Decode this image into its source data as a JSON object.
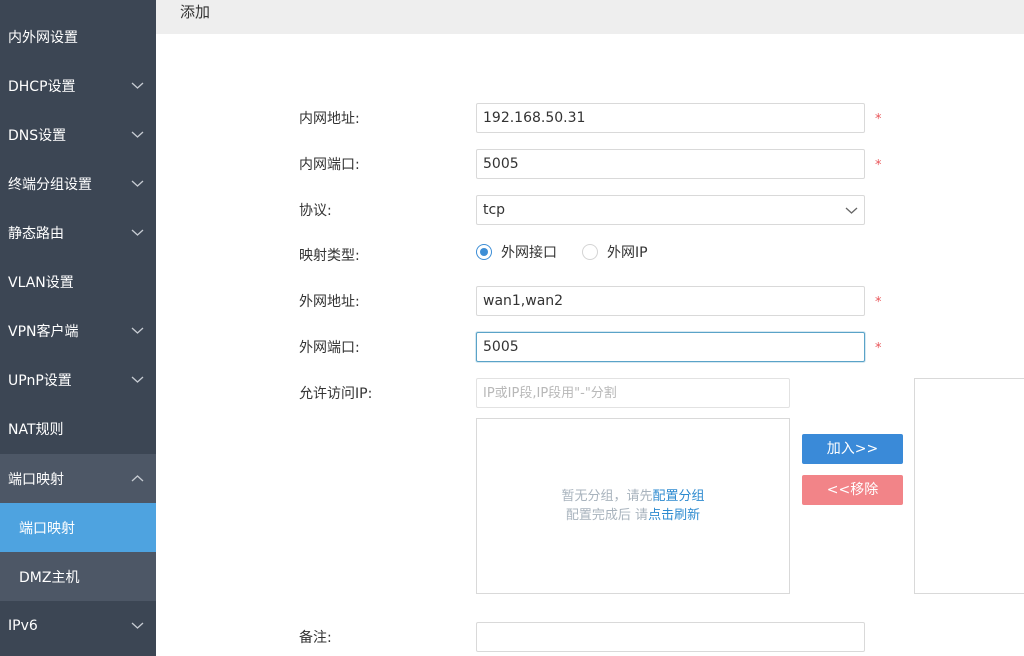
{
  "sidebar": {
    "items": [
      {
        "label": "内外网设置",
        "chevron": false
      },
      {
        "label": "DHCP设置",
        "chevron": true
      },
      {
        "label": "DNS设置",
        "chevron": true
      },
      {
        "label": "终端分组设置",
        "chevron": true
      },
      {
        "label": "静态路由",
        "chevron": true
      },
      {
        "label": "VLAN设置",
        "chevron": false
      },
      {
        "label": "VPN客户端",
        "chevron": true
      },
      {
        "label": "UPnP设置",
        "chevron": true
      },
      {
        "label": "NAT规则",
        "chevron": false
      },
      {
        "label": "端口映射",
        "chevron": true,
        "expanded": true
      },
      {
        "label": "端口映射",
        "sub": true,
        "active": true
      },
      {
        "label": "DMZ主机",
        "sub": true
      },
      {
        "label": "IPv6",
        "chevron": true
      }
    ]
  },
  "header": {
    "title": "添加"
  },
  "form": {
    "lan_ip": {
      "label": "内网地址:",
      "value": "192.168.50.31"
    },
    "lan_port": {
      "label": "内网端口:",
      "value": "5005"
    },
    "protocol": {
      "label": "协议:",
      "value": "tcp"
    },
    "map_type": {
      "label": "映射类型:",
      "options": [
        "外网接口",
        "外网IP"
      ],
      "selected": 0
    },
    "wan_addr": {
      "label": "外网地址:",
      "value": "wan1,wan2"
    },
    "wan_port": {
      "label": "外网端口:",
      "value": "5005"
    },
    "allow_ip": {
      "label": "允许访问IP:",
      "placeholder": "IP或IP段,IP段用\"-\"分割",
      "empty_line1_prefix": "暂无分组，请先",
      "empty_line1_link": "配置分组",
      "empty_line2_prefix": "配置完成后 请",
      "empty_line2_link": "点击刷新"
    },
    "remark": {
      "label": "备注:",
      "value": ""
    },
    "required_mark": "*"
  },
  "buttons": {
    "add": "加入>>",
    "remove": "<<移除"
  },
  "colors": {
    "sidebar_bg": "#3c4654",
    "sidebar_open": "#4d5766",
    "active": "#4ea3e0",
    "add_btn": "#3a8ad8",
    "remove_btn": "#f28488",
    "required": "#e9565a"
  }
}
